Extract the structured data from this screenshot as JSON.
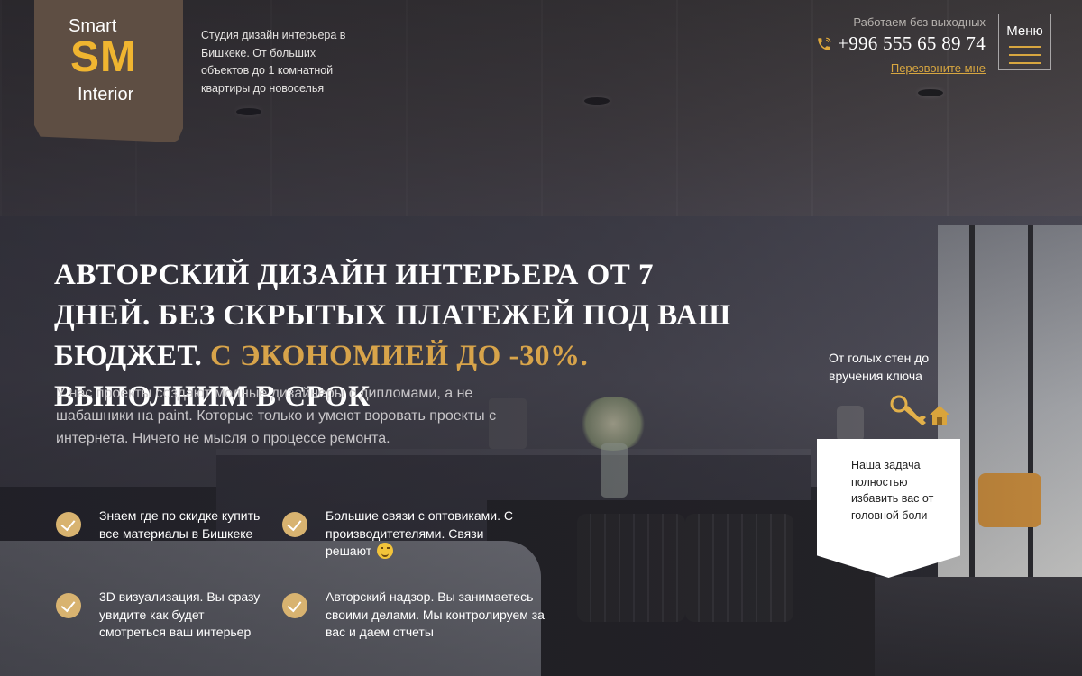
{
  "brand": {
    "logo_top": "Smart",
    "logo_mark": "SM",
    "logo_bottom": "Interior",
    "tagline": "Студия дизайн интерьера в Бишкеке. От больших объектов до 1 комнатной квартиры до новоселья",
    "accent_color": "#d8a44a",
    "logo_bg_color": "#5e4e43"
  },
  "header": {
    "work_hours": "Работаем без выходных",
    "phone": "+996 555 65 89 74",
    "callback_link": "Перезвоните мне",
    "menu_label": "Меню",
    "phone_icon": "phone-icon",
    "menu_icon": "hamburger-icon"
  },
  "hero": {
    "headline_part1": "Авторский дизайн интерьера от 7 дней. Без скрытых платежей под ваш бюджет.",
    "headline_accent": "С экономией до -30%.",
    "headline_part2": "Выполним в срок",
    "subtext": "У нас проекты создают модные дизайнеры с дипломами, а не шабашники на paint. Которые только и умеют воровать проекты с интернета. Ничего не мысля о процессе ремонта."
  },
  "features": [
    {
      "text": "Знаем где по скидке купить все материалы в Бишкеке",
      "icon": "check-icon"
    },
    {
      "text": "Большие связи с оптовиками. С производитетелями. Связи решают",
      "icon": "check-icon",
      "emoji": "smiley-icon"
    },
    {
      "text": "3D визуализация. Вы сразу увидите как будет смотреться ваш интерьер",
      "icon": "check-icon"
    },
    {
      "text": "Авторский надзор. Вы занимаетесь своими делами. Мы контролируем за вас и даем отчеты",
      "icon": "check-icon"
    }
  ],
  "side_card": {
    "turnkey_text": "От голых стен до вручения ключа",
    "key_icon": "key-house-icon",
    "ribbon_text": "Наша задача полностью избавить вас от головной боли"
  }
}
